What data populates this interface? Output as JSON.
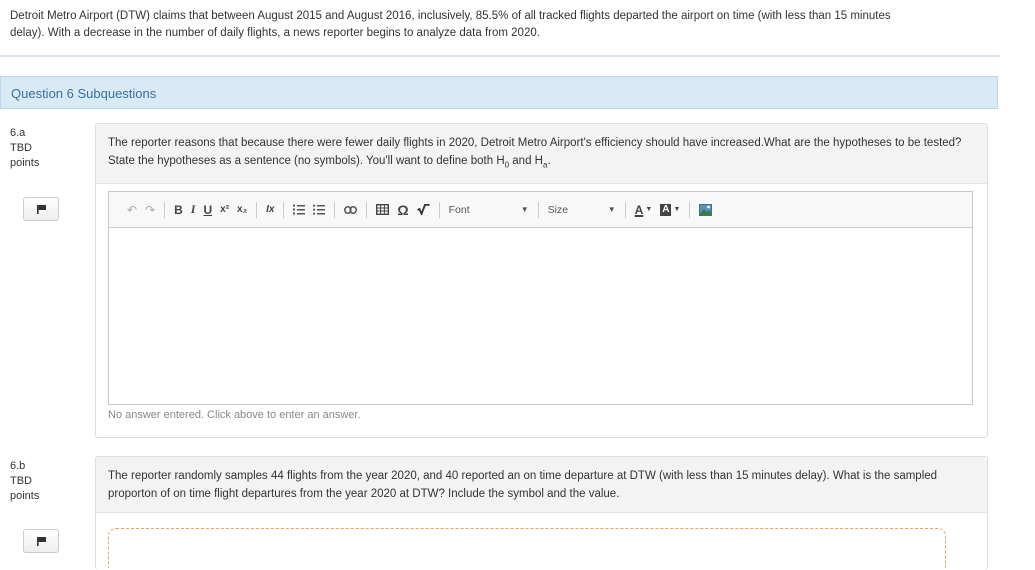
{
  "intro": "Detroit Metro Airport (DTW) claims that between August 2015 and August 2016, inclusively, 85.5% of all tracked flights departed the airport on time (with less than 15 minutes delay). With a decrease in the number of daily flights, a news reporter begins to analyze data from 2020.",
  "section_title": "Question 6 Subquestions",
  "questions": [
    {
      "id": "6.a",
      "points_value": "TBD",
      "points_label": "points",
      "prompt_main": "The reporter reasons that because there were fewer daily flights in 2020, Detroit Metro Airport's efficiency should have increased.What are the hypotheses to be tested? State the hypotheses as a sentence (no symbols). You'll want to define both H",
      "prompt_sub0": "0",
      "prompt_and": " and H",
      "prompt_suba": "a",
      "prompt_end": ".",
      "answer_hint": "No answer entered. Click above to enter an answer."
    },
    {
      "id": "6.b",
      "points_value": "TBD",
      "points_label": "points",
      "prompt_main": "The reporter randomly samples 44 flights from the year 2020, and 40 reported an on time departure at DTW (with less than 15 minutes delay). What is the sampled proporton of on time flight departures from the year 2020 at DTW? Include the symbol and the value."
    }
  ],
  "toolbar": {
    "bold": "B",
    "italic": "I",
    "underline": "U",
    "superscript": "x²",
    "subscript": "x₂",
    "remove_format": "Ix",
    "omega": "Ω",
    "font_label": "Font",
    "size_label": "Size",
    "text_color": "A",
    "bg_color": "A"
  }
}
